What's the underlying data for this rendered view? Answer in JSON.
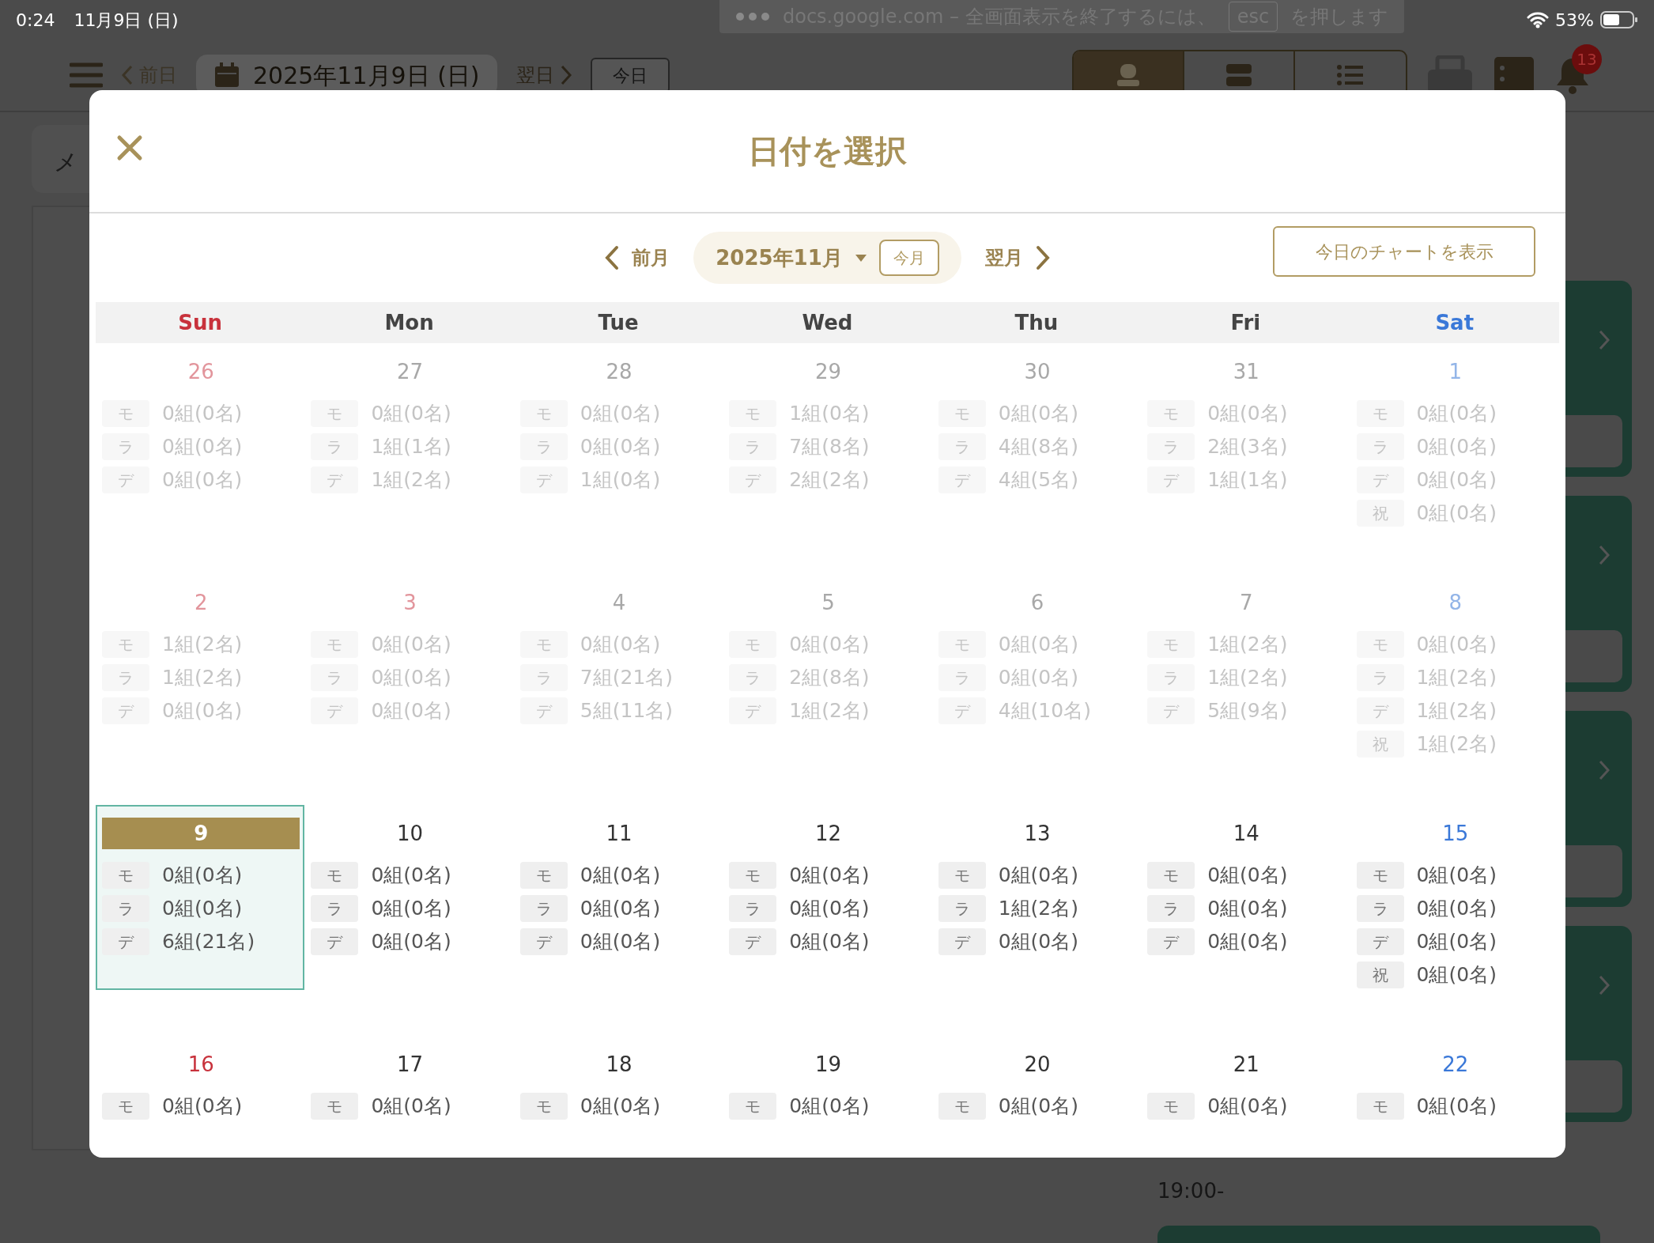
{
  "status_bar": {
    "time": "0:24",
    "date": "11月9日 (日)",
    "battery": "53%"
  },
  "fullscreen_notice": {
    "message": "docs.google.com – 全画面表示を終了するには、",
    "key": "esc",
    "suffix": "を押します"
  },
  "app_header": {
    "prev_day": "前日",
    "date": "2025年11月9日 (日)",
    "next_day": "翌日",
    "today": "今日",
    "view_tabs": [
      {
        "selected": true
      },
      {
        "selected": false
      },
      {
        "selected": false
      }
    ],
    "notification_count": "13"
  },
  "background": {
    "menu_label": "メ",
    "time_label": "19:00-"
  },
  "dialog": {
    "title": "日付を選択",
    "prev_month": "前月",
    "month": "2025年11月",
    "this_month": "今月",
    "next_month": "翌月",
    "chart_button": "今日のチャートを表示",
    "weekdays": [
      {
        "label": "Sun",
        "kind": "sunday"
      },
      {
        "label": "Mon",
        "kind": "weekday"
      },
      {
        "label": "Tue",
        "kind": "weekday"
      },
      {
        "label": "Wed",
        "kind": "weekday"
      },
      {
        "label": "Thu",
        "kind": "weekday"
      },
      {
        "label": "Fri",
        "kind": "weekday"
      },
      {
        "label": "Sat",
        "kind": "saturday"
      }
    ],
    "weeks": [
      {
        "days": [
          {
            "date": "26",
            "kind": "sunday",
            "past": true,
            "selected": false,
            "entries": [
              {
                "tag": "モ",
                "value": "0組(0名)"
              },
              {
                "tag": "ラ",
                "value": "0組(0名)"
              },
              {
                "tag": "デ",
                "value": "0組(0名)"
              }
            ]
          },
          {
            "date": "27",
            "kind": "weekday",
            "past": true,
            "selected": false,
            "entries": [
              {
                "tag": "モ",
                "value": "0組(0名)"
              },
              {
                "tag": "ラ",
                "value": "1組(1名)"
              },
              {
                "tag": "デ",
                "value": "1組(2名)"
              }
            ]
          },
          {
            "date": "28",
            "kind": "weekday",
            "past": true,
            "selected": false,
            "entries": [
              {
                "tag": "モ",
                "value": "0組(0名)"
              },
              {
                "tag": "ラ",
                "value": "0組(0名)"
              },
              {
                "tag": "デ",
                "value": "1組(0名)"
              }
            ]
          },
          {
            "date": "29",
            "kind": "weekday",
            "past": true,
            "selected": false,
            "entries": [
              {
                "tag": "モ",
                "value": "1組(0名)"
              },
              {
                "tag": "ラ",
                "value": "7組(8名)"
              },
              {
                "tag": "デ",
                "value": "2組(2名)"
              }
            ]
          },
          {
            "date": "30",
            "kind": "weekday",
            "past": true,
            "selected": false,
            "entries": [
              {
                "tag": "モ",
                "value": "0組(0名)"
              },
              {
                "tag": "ラ",
                "value": "4組(8名)"
              },
              {
                "tag": "デ",
                "value": "4組(5名)"
              }
            ]
          },
          {
            "date": "31",
            "kind": "weekday",
            "past": true,
            "selected": false,
            "entries": [
              {
                "tag": "モ",
                "value": "0組(0名)"
              },
              {
                "tag": "ラ",
                "value": "2組(3名)"
              },
              {
                "tag": "デ",
                "value": "1組(1名)"
              }
            ]
          },
          {
            "date": "1",
            "kind": "saturday",
            "past": true,
            "selected": false,
            "entries": [
              {
                "tag": "モ",
                "value": "0組(0名)"
              },
              {
                "tag": "ラ",
                "value": "0組(0名)"
              },
              {
                "tag": "デ",
                "value": "0組(0名)"
              },
              {
                "tag": "祝",
                "value": "0組(0名)"
              }
            ]
          }
        ]
      },
      {
        "days": [
          {
            "date": "2",
            "kind": "sunday",
            "past": true,
            "selected": false,
            "entries": [
              {
                "tag": "モ",
                "value": "1組(2名)"
              },
              {
                "tag": "ラ",
                "value": "1組(2名)"
              },
              {
                "tag": "デ",
                "value": "0組(0名)"
              }
            ]
          },
          {
            "date": "3",
            "kind": "holiday",
            "past": true,
            "selected": false,
            "entries": [
              {
                "tag": "モ",
                "value": "0組(0名)"
              },
              {
                "tag": "ラ",
                "value": "0組(0名)"
              },
              {
                "tag": "デ",
                "value": "0組(0名)"
              }
            ]
          },
          {
            "date": "4",
            "kind": "weekday",
            "past": true,
            "selected": false,
            "entries": [
              {
                "tag": "モ",
                "value": "0組(0名)"
              },
              {
                "tag": "ラ",
                "value": "7組(21名)"
              },
              {
                "tag": "デ",
                "value": "5組(11名)"
              }
            ]
          },
          {
            "date": "5",
            "kind": "weekday",
            "past": true,
            "selected": false,
            "entries": [
              {
                "tag": "モ",
                "value": "0組(0名)"
              },
              {
                "tag": "ラ",
                "value": "2組(8名)"
              },
              {
                "tag": "デ",
                "value": "1組(2名)"
              }
            ]
          },
          {
            "date": "6",
            "kind": "weekday",
            "past": true,
            "selected": false,
            "entries": [
              {
                "tag": "モ",
                "value": "0組(0名)"
              },
              {
                "tag": "ラ",
                "value": "0組(0名)"
              },
              {
                "tag": "デ",
                "value": "4組(10名)"
              }
            ]
          },
          {
            "date": "7",
            "kind": "weekday",
            "past": true,
            "selected": false,
            "entries": [
              {
                "tag": "モ",
                "value": "1組(2名)"
              },
              {
                "tag": "ラ",
                "value": "1組(2名)"
              },
              {
                "tag": "デ",
                "value": "5組(9名)"
              }
            ]
          },
          {
            "date": "8",
            "kind": "saturday",
            "past": true,
            "selected": false,
            "entries": [
              {
                "tag": "モ",
                "value": "0組(0名)"
              },
              {
                "tag": "ラ",
                "value": "1組(2名)"
              },
              {
                "tag": "デ",
                "value": "1組(2名)"
              },
              {
                "tag": "祝",
                "value": "1組(2名)"
              }
            ]
          }
        ]
      },
      {
        "days": [
          {
            "date": "9",
            "kind": "sunday",
            "past": false,
            "selected": true,
            "entries": [
              {
                "tag": "モ",
                "value": "0組(0名)"
              },
              {
                "tag": "ラ",
                "value": "0組(0名)"
              },
              {
                "tag": "デ",
                "value": "6組(21名)"
              }
            ]
          },
          {
            "date": "10",
            "kind": "weekday",
            "past": false,
            "selected": false,
            "entries": [
              {
                "tag": "モ",
                "value": "0組(0名)"
              },
              {
                "tag": "ラ",
                "value": "0組(0名)"
              },
              {
                "tag": "デ",
                "value": "0組(0名)"
              }
            ]
          },
          {
            "date": "11",
            "kind": "weekday",
            "past": false,
            "selected": false,
            "entries": [
              {
                "tag": "モ",
                "value": "0組(0名)"
              },
              {
                "tag": "ラ",
                "value": "0組(0名)"
              },
              {
                "tag": "デ",
                "value": "0組(0名)"
              }
            ]
          },
          {
            "date": "12",
            "kind": "weekday",
            "past": false,
            "selected": false,
            "entries": [
              {
                "tag": "モ",
                "value": "0組(0名)"
              },
              {
                "tag": "ラ",
                "value": "0組(0名)"
              },
              {
                "tag": "デ",
                "value": "0組(0名)"
              }
            ]
          },
          {
            "date": "13",
            "kind": "weekday",
            "past": false,
            "selected": false,
            "entries": [
              {
                "tag": "モ",
                "value": "0組(0名)"
              },
              {
                "tag": "ラ",
                "value": "1組(2名)"
              },
              {
                "tag": "デ",
                "value": "0組(0名)"
              }
            ]
          },
          {
            "date": "14",
            "kind": "weekday",
            "past": false,
            "selected": false,
            "entries": [
              {
                "tag": "モ",
                "value": "0組(0名)"
              },
              {
                "tag": "ラ",
                "value": "0組(0名)"
              },
              {
                "tag": "デ",
                "value": "0組(0名)"
              }
            ]
          },
          {
            "date": "15",
            "kind": "saturday",
            "past": false,
            "selected": false,
            "entries": [
              {
                "tag": "モ",
                "value": "0組(0名)"
              },
              {
                "tag": "ラ",
                "value": "0組(0名)"
              },
              {
                "tag": "デ",
                "value": "0組(0名)"
              },
              {
                "tag": "祝",
                "value": "0組(0名)"
              }
            ]
          }
        ]
      },
      {
        "days": [
          {
            "date": "16",
            "kind": "sunday",
            "past": false,
            "selected": false,
            "entries": [
              {
                "tag": "モ",
                "value": "0組(0名)"
              }
            ]
          },
          {
            "date": "17",
            "kind": "weekday",
            "past": false,
            "selected": false,
            "entries": [
              {
                "tag": "モ",
                "value": "0組(0名)"
              }
            ]
          },
          {
            "date": "18",
            "kind": "weekday",
            "past": false,
            "selected": false,
            "entries": [
              {
                "tag": "モ",
                "value": "0組(0名)"
              }
            ]
          },
          {
            "date": "19",
            "kind": "weekday",
            "past": false,
            "selected": false,
            "entries": [
              {
                "tag": "モ",
                "value": "0組(0名)"
              }
            ]
          },
          {
            "date": "20",
            "kind": "weekday",
            "past": false,
            "selected": false,
            "entries": [
              {
                "tag": "モ",
                "value": "0組(0名)"
              }
            ]
          },
          {
            "date": "21",
            "kind": "weekday",
            "past": false,
            "selected": false,
            "entries": [
              {
                "tag": "モ",
                "value": "0組(0名)"
              }
            ]
          },
          {
            "date": "22",
            "kind": "saturday",
            "past": false,
            "selected": false,
            "entries": [
              {
                "tag": "モ",
                "value": "0組(0名)"
              }
            ]
          }
        ]
      }
    ]
  }
}
